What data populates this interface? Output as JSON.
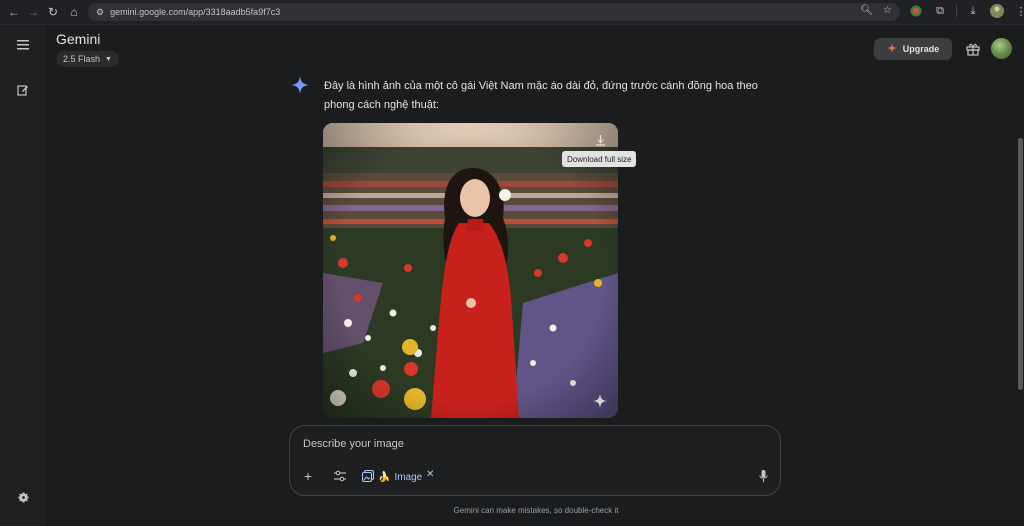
{
  "browser": {
    "url": "gemini.google.com/app/3318aadb5fa9f7c3"
  },
  "header": {
    "app_title": "Gemini",
    "model_label": "2.5 Flash",
    "upgrade_label": "Upgrade"
  },
  "response": {
    "text": "Đây là hình ảnh của một cô gái Việt Nam mặc áo dài đỏ, đứng trước cánh đồng hoa theo phong cách nghệ thuật:",
    "tooltip": "Download full size"
  },
  "composer": {
    "placeholder": "Describe your image",
    "image_chip_label": "Image",
    "chip_emoji": "🍌"
  },
  "footer": {
    "disclaimer": "Gemini can make mistakes, so double-check it"
  },
  "colors": {
    "background": "#1b1c1d",
    "accent_link": "#a8c7fa",
    "dress_red": "#c8211c"
  }
}
